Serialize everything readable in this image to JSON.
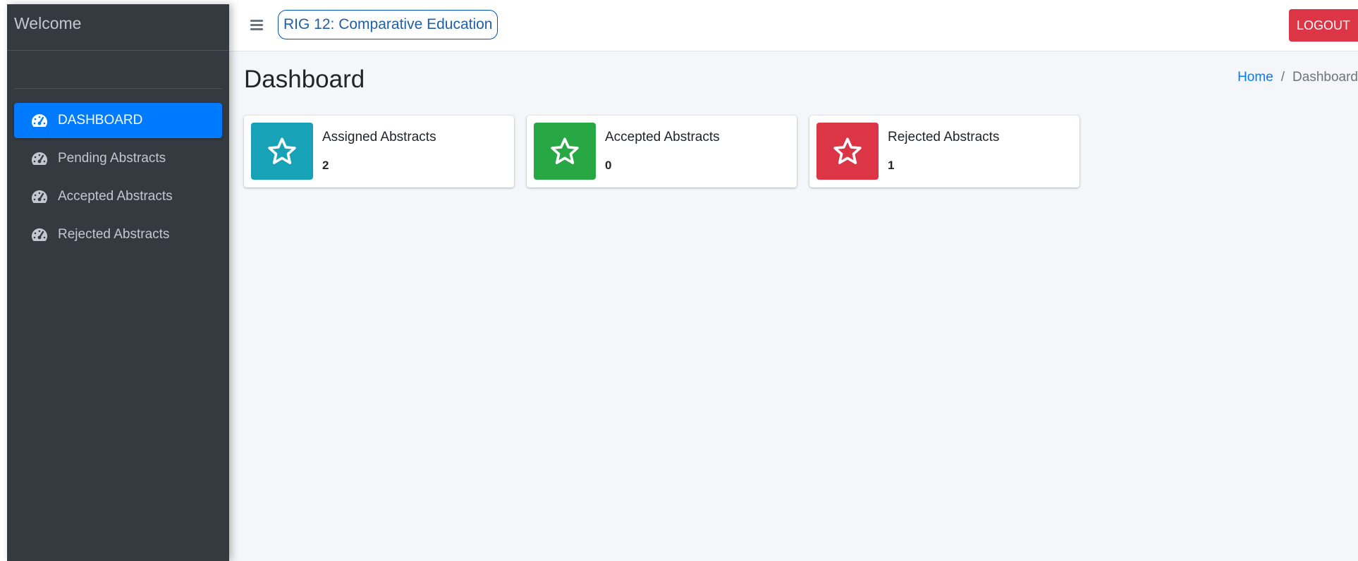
{
  "sidebar": {
    "brand": "Welcome",
    "items": [
      {
        "label": "DASHBOARD",
        "icon": "tachometer-icon",
        "active": true
      },
      {
        "label": "Pending Abstracts",
        "icon": "tachometer-icon",
        "active": false
      },
      {
        "label": "Accepted Abstracts",
        "icon": "tachometer-icon",
        "active": false
      },
      {
        "label": "Rejected Abstracts",
        "icon": "tachometer-icon",
        "active": false
      }
    ]
  },
  "topbar": {
    "menu_icon": "hamburger-icon",
    "rig_label": "RIG 12: Comparative Education",
    "logout_label": "LOGOUT"
  },
  "content": {
    "title": "Dashboard",
    "breadcrumb": {
      "home": "Home",
      "separator": "/",
      "current": "Dashboard"
    }
  },
  "info_boxes": [
    {
      "title": "Assigned Abstracts",
      "value": "2",
      "icon": "star-icon",
      "color": "#17a2b8"
    },
    {
      "title": "Accepted Abstracts",
      "value": "0",
      "icon": "star-icon",
      "color": "#28a745"
    },
    {
      "title": "Rejected Abstracts",
      "value": "1",
      "icon": "star-icon",
      "color": "#dc3545"
    }
  ],
  "colors": {
    "sidebar_bg": "#343a40",
    "active_item": "#007bff",
    "logout": "#dc3545",
    "content_bg": "#f4f6f9"
  }
}
